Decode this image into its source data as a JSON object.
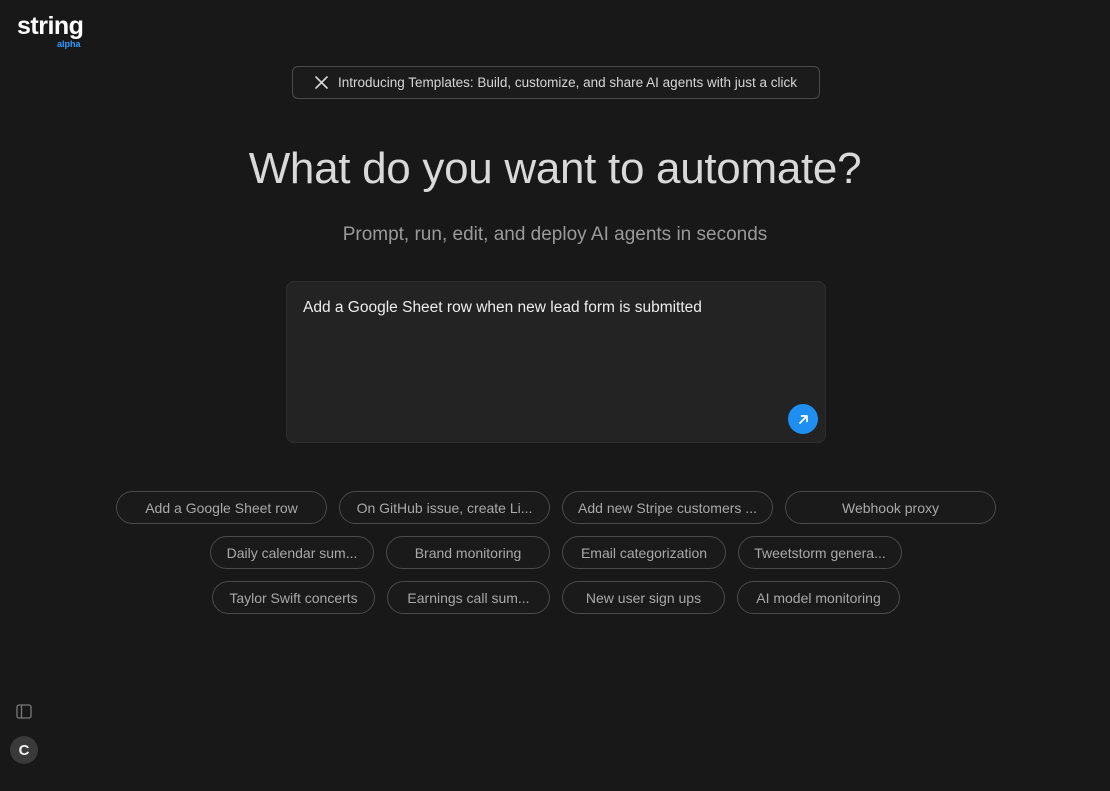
{
  "brand": {
    "name": "string",
    "tag": "alpha"
  },
  "announcement": {
    "icon": "x-logo-icon",
    "text": "Introducing Templates: Build, customize, and share AI agents with just a click"
  },
  "hero": {
    "title": "What do you want to automate?",
    "subtitle": "Prompt, run, edit, and deploy AI agents in seconds"
  },
  "prompt": {
    "value": "Add a Google Sheet row when new lead form is submitted",
    "send_icon": "arrow-up-right-icon"
  },
  "suggestions": [
    "Add a Google Sheet row",
    "On GitHub issue, create Li...",
    "Add new Stripe customers ...",
    "Webhook proxy",
    "Daily calendar sum...",
    "Brand monitoring",
    "Email categorization",
    "Tweetstorm genera...",
    "Taylor Swift concerts",
    "Earnings call sum...",
    "New user sign ups",
    "AI model monitoring"
  ],
  "user": {
    "initial": "C"
  },
  "colors": {
    "accent": "#1e8ef0",
    "background": "#181818",
    "brand_tag": "#2f9bff"
  }
}
